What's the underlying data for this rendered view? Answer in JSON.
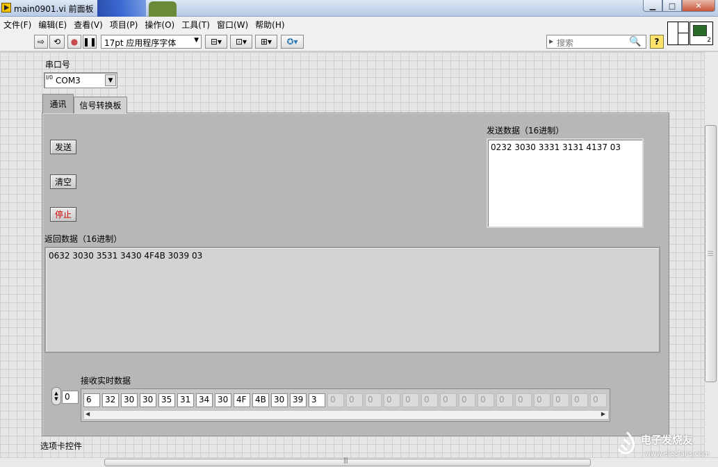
{
  "window": {
    "title": "main0901.vi 前面板"
  },
  "menu": [
    "文件(F)",
    "编辑(E)",
    "查看(V)",
    "项目(P)",
    "操作(O)",
    "工具(T)",
    "窗口(W)",
    "帮助(H)"
  ],
  "toolbar": {
    "font": "17pt 应用程序字体",
    "search_placeholder": "搜索",
    "help_label": "?"
  },
  "vi_icon": {
    "number": "2"
  },
  "serial": {
    "label": "串口号",
    "value": "COM3",
    "io_glyph": "I/0"
  },
  "tabs": [
    {
      "label": "通讯",
      "selected": true
    },
    {
      "label": "信号转换板",
      "selected": false
    }
  ],
  "buttons": {
    "send": "发送",
    "clear": "清空",
    "stop": "停止"
  },
  "send_data": {
    "label": "发送数据（16进制）",
    "value": "0232 3030 3331 3131 4137 03"
  },
  "return_data": {
    "label": "返回数据（16进制）",
    "value": "0632 3030 3531 3430 4F4B 3039 03"
  },
  "realtime": {
    "label": "接收实时数据",
    "index": "0",
    "cells": [
      "6",
      "32",
      "30",
      "30",
      "35",
      "31",
      "34",
      "30",
      "4F",
      "4B",
      "30",
      "39",
      "3"
    ],
    "empty_cells": [
      "0",
      "0",
      "0",
      "0",
      "0",
      "0",
      "0",
      "0",
      "0",
      "0",
      "0",
      "0",
      "0",
      "0",
      "0"
    ]
  },
  "tab_caption": "选项卡控件",
  "watermark": {
    "brand": "电子发烧友",
    "url": "www.elecfans.com"
  },
  "colors": {
    "stop_text": "#d10000",
    "tab_body": "#b7b7b7",
    "panel_grid": "#e6e6e6"
  }
}
